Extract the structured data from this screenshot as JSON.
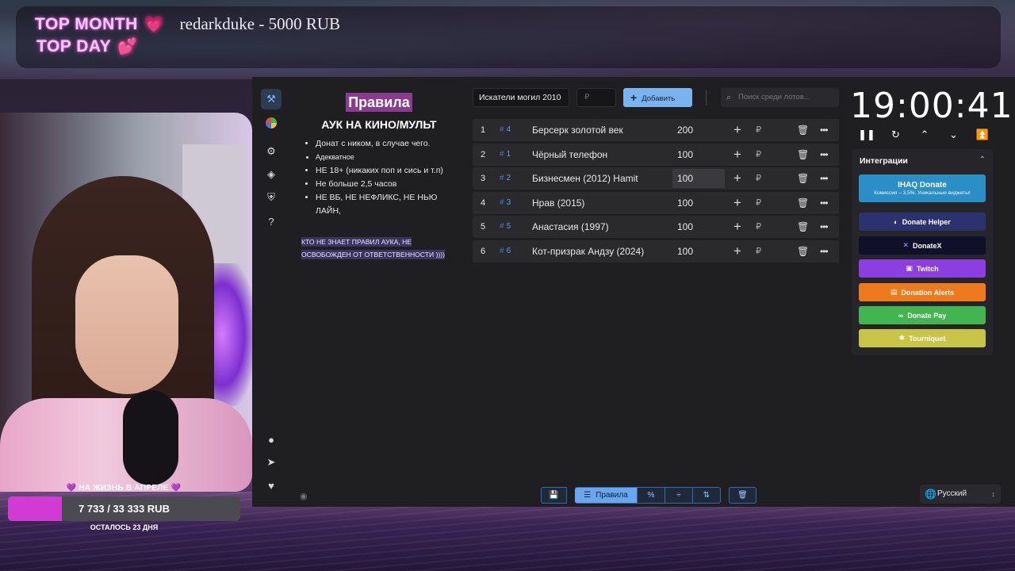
{
  "banner": {
    "top_month_label": "TOP MONTH",
    "top_month_value": "redarkduke - 5000 RUB",
    "top_day_label": "TOP DAY"
  },
  "goal": {
    "title": "НА ЖИЗНЬ В АПРЕЛЕ",
    "progress_text": "7 733 / 33 333 RUB",
    "current": 7733,
    "target": 33333,
    "remaining": "ОСТАЛОСЬ 23 ДНЯ",
    "fill_color": "#d23ad4"
  },
  "rules": {
    "title": "Правила",
    "subtitle": "АУК НА КИНО/МУЛЬТ",
    "items": [
      "Донат с ником, в случае чего.",
      "Адекватное",
      "НЕ 18+ (никаких поп и сись и т.п)",
      "Не больше 2,5 часов",
      "НЕ ВБ, НЕ НЕФЛИКС, НЕ НЬЮ ЛАЙН,"
    ],
    "note": "КТО НЕ ЗНАЕТ ПРАВИЛ АУКА, НЕ ОСВОБОЖДЕН ОТ ОТВЕТСТВЕННОСТИ ))))"
  },
  "toolbar": {
    "lot_name_value": "Искатели могил 2010",
    "amount_placeholder": "₽",
    "add_label": "Добавить",
    "search_placeholder": "Поиск среди лотов..."
  },
  "lots": [
    {
      "index": "1",
      "id": "4",
      "name": "Берсерк золотой век",
      "amount": "200"
    },
    {
      "index": "2",
      "id": "1",
      "name": "Чёрный телефон",
      "amount": "100"
    },
    {
      "index": "3",
      "id": "2",
      "name": "Бизнесмен (2012) Hamit",
      "amount": "100"
    },
    {
      "index": "4",
      "id": "3",
      "name": "Нрав (2015)",
      "amount": "100"
    },
    {
      "index": "5",
      "id": "5",
      "name": "Анастасия (1997)",
      "amount": "100"
    },
    {
      "index": "6",
      "id": "6",
      "name": "Кот-призрак Андзу (2024)",
      "amount": "100"
    }
  ],
  "currency": "₽",
  "bottombar": {
    "rules_label": "Правила"
  },
  "language": "Русский",
  "timer": "19:00:41",
  "integrations": {
    "header": "Интеграции",
    "ihaq_title": "IHAQ Donate",
    "ihaq_sub": "Комиссия – 3,5%. Уникальные виджеты!",
    "donate_helper": "Donate Helper",
    "donatex": "DonateX",
    "twitch": "Twitch",
    "donation_alerts": "Donation Alerts",
    "donate_pay": "Donate Pay",
    "tourniquet": "Tourniquet"
  },
  "colors": {
    "accent": "#7ab3ee",
    "rules_title_bg": "#8b3a8f",
    "twitch": "#8c3ee0",
    "donation_alerts": "#ef7a1e",
    "donate_pay": "#43b54f",
    "tourniquet": "#c8c448"
  }
}
